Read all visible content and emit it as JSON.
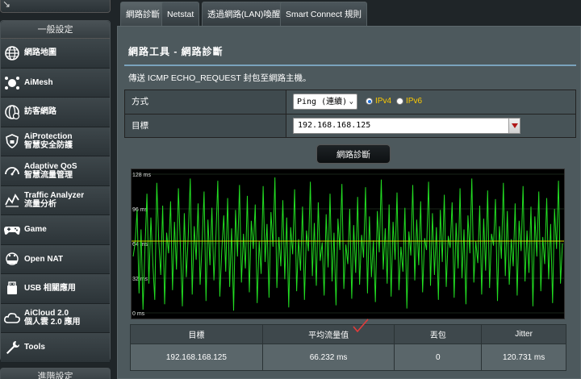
{
  "sidebar": {
    "section_title": "一般設定",
    "next_section_title": "進階設定",
    "items": [
      {
        "label": "網路地圖",
        "sub": "",
        "icon": "globe-icon"
      },
      {
        "label": "AiMesh",
        "sub": "",
        "icon": "aimesh-icon"
      },
      {
        "label": "訪客網路",
        "sub": "",
        "icon": "guest-network-icon"
      },
      {
        "label": "AiProtection",
        "sub": "智慧安全防護",
        "icon": "shield-icon"
      },
      {
        "label": "Adaptive QoS",
        "sub": "智慧流量管理",
        "icon": "speedometer-icon"
      },
      {
        "label": "Traffic Analyzer",
        "sub": "流量分析",
        "icon": "traffic-chart-icon"
      },
      {
        "label": "Game",
        "sub": "",
        "icon": "gamepad-icon"
      },
      {
        "label": "Open NAT",
        "sub": "",
        "icon": "open-nat-icon"
      },
      {
        "label": "USB 相關應用",
        "sub": "",
        "icon": "usb-icon"
      },
      {
        "label": "AiCloud 2.0",
        "sub": "個人雲 2.0 應用",
        "icon": "cloud-icon"
      },
      {
        "label": "Tools",
        "sub": "",
        "icon": "wrench-icon"
      }
    ]
  },
  "tabs": [
    {
      "label": "網路診斷",
      "active": true
    },
    {
      "label": "Netstat",
      "active": false
    },
    {
      "label": "透過網路(LAN)喚醒",
      "active": false
    },
    {
      "label": "Smart Connect 規則",
      "active": false
    }
  ],
  "panel": {
    "title": "網路工具 - 網路診斷",
    "description": "傳送 ICMP ECHO_REQUEST 封包至網路主機。",
    "method_label": "方式",
    "method_value": "Ping (連續)",
    "ipv4_label": "IPv4",
    "ipv6_label": "IPv6",
    "ip_selected": "IPv4",
    "target_label": "目標",
    "target_value": "192.168.168.125",
    "diagnose_button": "網路診斷"
  },
  "chart_data": {
    "type": "line",
    "ylim": [
      0,
      128
    ],
    "yticks": [
      "128 ms",
      "96 ms",
      "64 ms",
      "32 ms",
      "0 ms"
    ],
    "average_ms": 66.232,
    "line_color": "#22dd22",
    "average_color": "#dddd00",
    "series": [
      {
        "values": [
          52,
          64,
          95,
          18,
          77,
          3,
          58,
          110,
          27,
          88,
          46,
          12,
          120,
          67,
          35,
          99,
          8,
          74,
          55,
          103,
          21,
          84,
          40,
          115,
          60,
          6,
          92,
          33,
          71,
          124,
          17,
          80,
          49,
          101,
          26,
          63,
          112,
          11,
          86,
          44,
          97,
          30,
          69,
          122,
          15,
          57,
          90,
          38,
          106,
          24,
          78,
          2,
          95,
          52,
          118,
          28,
          73,
          41,
          108,
          19,
          85,
          59,
          100,
          9,
          66,
          36,
          117,
          47,
          82,
          14,
          93,
          61,
          125,
          23,
          70,
          43,
          104,
          31,
          88,
          5,
          79,
          54,
          114,
          20,
          68,
          39,
          98,
          12,
          76,
          57,
          121,
          34,
          83,
          25,
          102,
          48,
          65,
          16,
          91,
          42,
          110,
          29,
          74,
          7,
          87,
          58,
          119,
          22,
          63,
          45,
          96,
          13,
          81,
          37,
          107,
          26,
          72,
          51,
          116,
          18,
          89,
          33,
          67,
          10,
          94,
          56,
          123,
          40,
          78,
          27,
          100,
          15,
          84,
          49,
          111,
          21,
          61,
          38,
          97,
          4,
          75,
          53,
          118,
          30,
          86,
          44,
          103,
          19,
          69,
          58,
          121,
          25,
          92,
          35,
          79,
          12,
          95,
          47,
          109,
          24,
          71,
          60,
          102,
          14,
          83,
          41,
          115,
          32,
          77,
          8,
          90,
          55,
          124,
          28,
          66,
          46,
          99,
          17,
          87,
          39,
          113,
          23,
          73,
          62,
          105,
          11,
          80,
          50,
          120,
          34,
          94,
          26,
          68,
          43,
          101,
          16,
          85,
          57,
          117,
          29,
          76,
          37,
          98,
          6,
          89,
          52,
          112,
          20,
          70,
          45,
          106,
          31,
          82,
          9,
          96,
          59,
          122,
          27,
          64
        ]
      }
    ]
  },
  "results": {
    "headers": [
      "目標",
      "平均流量值",
      "丟包",
      "Jitter"
    ],
    "values": [
      "192.168.168.125",
      "66.232 ms",
      "0",
      "120.731 ms"
    ]
  }
}
